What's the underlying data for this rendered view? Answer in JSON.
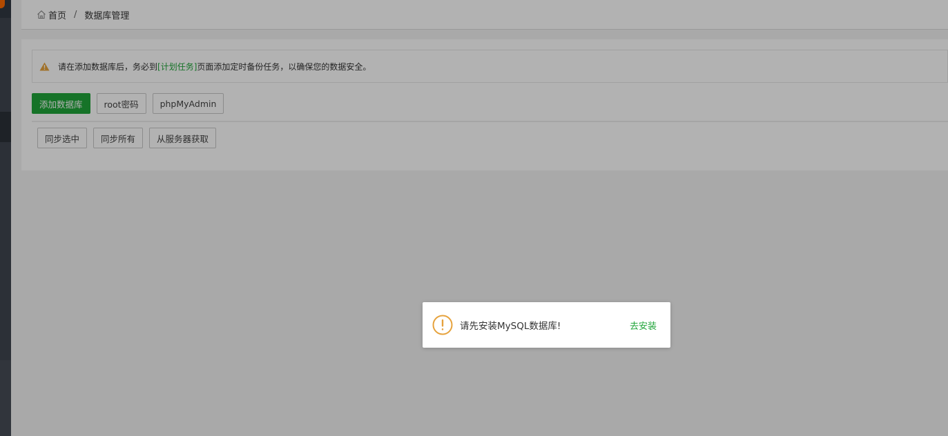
{
  "colors": {
    "accent": "#20a53a",
    "warning": "#e6a23c",
    "sidebar": "#3f4550",
    "badge": "#ff6a00"
  },
  "breadcrumb": {
    "home_icon": "home-icon",
    "home_label": "首页",
    "separator": "/",
    "current": "数据库管理"
  },
  "notice": {
    "icon": "warning-triangle-icon",
    "text_before": "请在添加数据库后，务必到",
    "link": "[计划任务]",
    "text_after": "页面添加定时备份任务，以确保您的数据安全。"
  },
  "toolbar": {
    "add_database": "添加数据库",
    "root_password": "root密码",
    "phpmyadmin": "phpMyAdmin"
  },
  "sync_toolbar": {
    "sync_selected": "同步选中",
    "sync_all": "同步所有",
    "fetch_from_server": "从服务器获取"
  },
  "dialog": {
    "icon": "exclamation-circle-icon",
    "message": "请先安装MySQL数据库!",
    "action": "去安装"
  }
}
